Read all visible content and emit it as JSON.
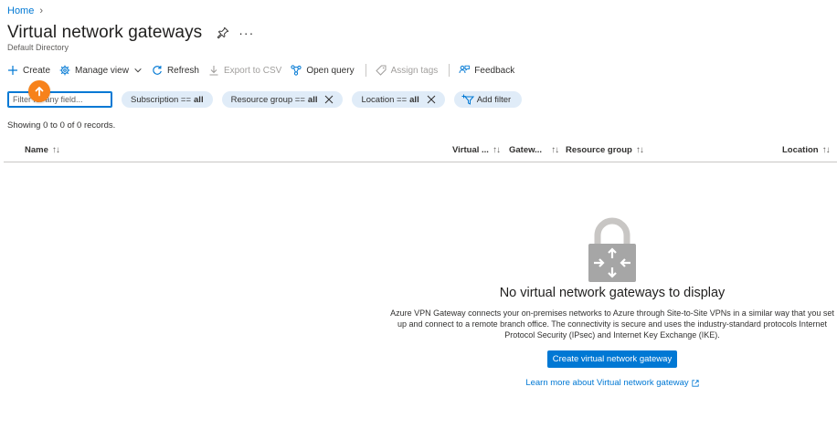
{
  "breadcrumb": {
    "home": "Home",
    "separator": ">"
  },
  "page": {
    "title": "Virtual network gateways",
    "subtitle": "Default Directory",
    "more": "···"
  },
  "toolbar": {
    "create": "Create",
    "manage_view": "Manage view",
    "refresh": "Refresh",
    "export_csv": "Export to CSV",
    "open_query": "Open query",
    "assign_tags": "Assign tags",
    "feedback": "Feedback"
  },
  "filters": {
    "placeholder": "Filter for any field...",
    "subscription": {
      "label": "Subscription ==",
      "value": "all"
    },
    "resource_group": {
      "label": "Resource group ==",
      "value": "all"
    },
    "location": {
      "label": "Location ==",
      "value": "all"
    },
    "add_filter": "Add filter"
  },
  "records_text": "Showing 0 to 0 of 0 records.",
  "columns": {
    "name": "Name",
    "virtual": "Virtual ...",
    "gateway": "Gatew...",
    "resource_group": "Resource group",
    "location": "Location",
    "sort_glyph": "↑↓"
  },
  "empty_state": {
    "heading": "No virtual network gateways to display",
    "description": "Azure VPN Gateway connects your on-premises networks to Azure through Site-to-Site VPNs in a similar way that you set up and connect to a remote branch office. The connectivity is secure and uses the industry-standard protocols Internet Protocol Security (IPsec) and Internet Key Exchange (IKE).",
    "cta": "Create virtual network gateway",
    "learn_more": "Learn more about Virtual network gateway"
  },
  "colors": {
    "accent": "#0078d4",
    "badge": "#f7821b",
    "pill_bg": "#e0ecf8"
  }
}
